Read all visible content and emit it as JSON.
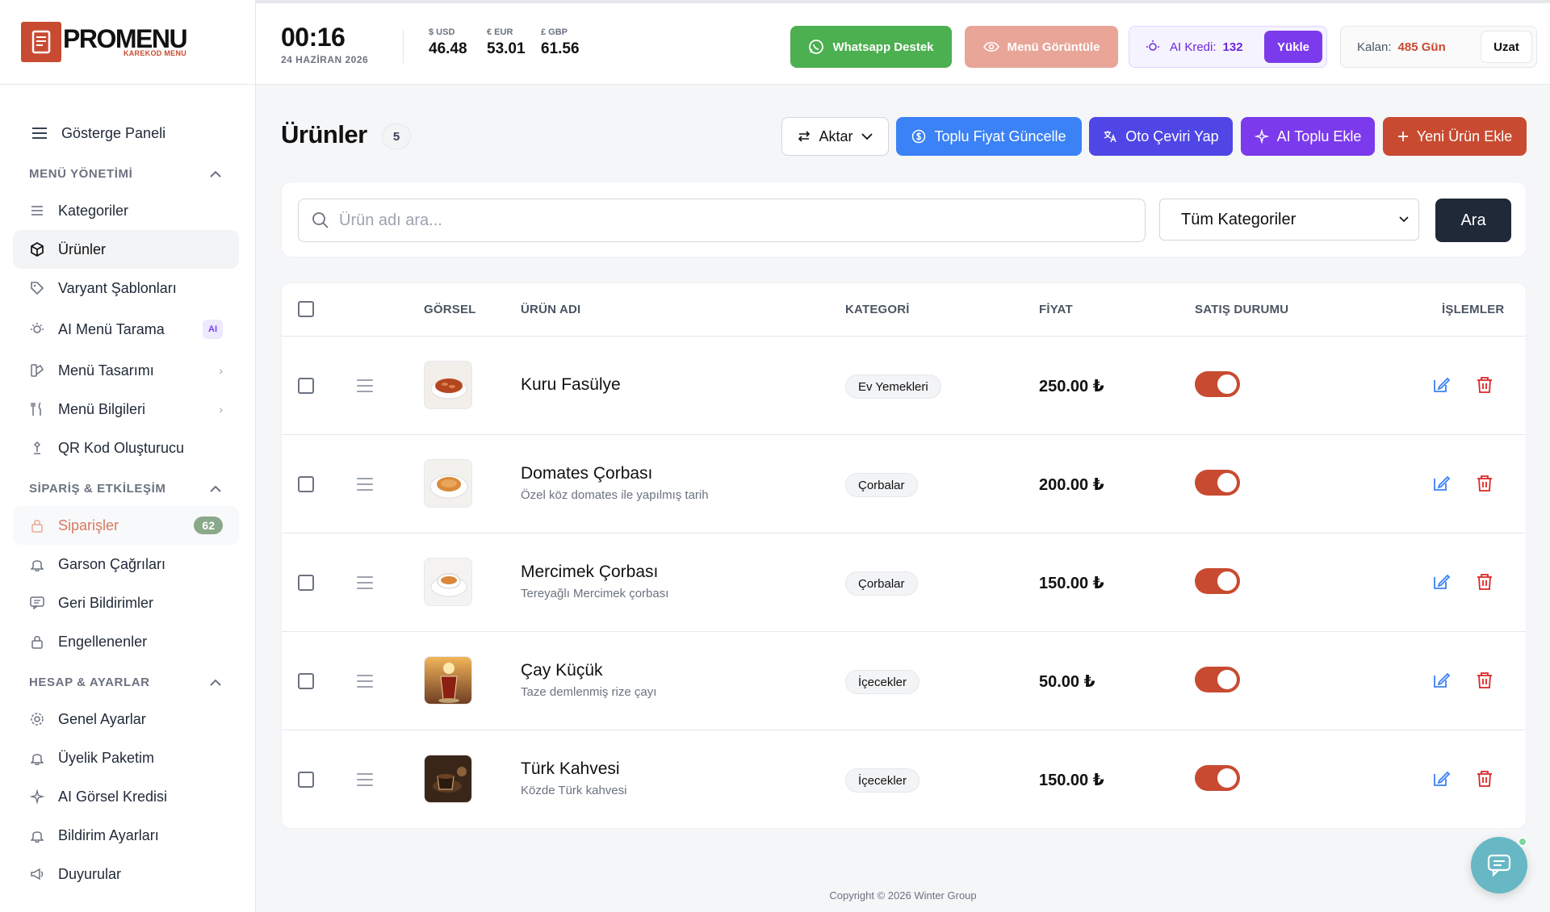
{
  "brand": {
    "name": "PROMENU",
    "sub": "KAREKOD MENU",
    "color": "#c84b31"
  },
  "header": {
    "time": "00:16",
    "date": "24 HAZİRAN 2026",
    "fx": [
      {
        "label": "$ USD",
        "value": "46.48"
      },
      {
        "label": "€ EUR",
        "value": "53.01"
      },
      {
        "label": "£ GBP",
        "value": "61.56"
      }
    ],
    "whatsapp_label": "Whatsapp Destek",
    "menu_view_label": "Menü Görüntüle",
    "ai_credit_label": "AI Kredi:",
    "ai_credit_value": "132",
    "load_label": "Yükle",
    "remaining_label": "Kalan:",
    "remaining_value": "485 Gün",
    "extend_label": "Uzat"
  },
  "sidebar": {
    "dashboard": "Gösterge Paneli",
    "sections": [
      {
        "title": "MENÜ YÖNETİMİ",
        "items": [
          "Kategoriler",
          "Ürünler",
          "Varyant Şablonları",
          "AI Menü Tarama",
          "Menü Tasarımı",
          "Menü Bilgileri",
          "QR Kod Oluşturucu"
        ]
      },
      {
        "title": "SİPARİŞ & ETKİLEŞİM",
        "items": [
          "Siparişler",
          "Garson Çağrıları",
          "Geri Bildirimler",
          "Engellenenler"
        ]
      },
      {
        "title": "HESAP & AYARLAR",
        "items": [
          "Genel Ayarlar",
          "Üyelik Paketim",
          "AI Görsel Kredisi",
          "Bildirim Ayarları",
          "Duyurular"
        ]
      }
    ],
    "ai_badge": "AI",
    "orders_count": "62"
  },
  "page": {
    "title": "Ürünler",
    "count": "5",
    "actions": {
      "aktar": "Aktar",
      "toplu": "Toplu Fiyat Güncelle",
      "ceviri": "Oto Çeviri Yap",
      "ai_toplu": "AI Toplu Ekle",
      "yeni": "Yeni Ürün Ekle"
    },
    "search_placeholder": "Ürün adı ara...",
    "category_select": "Tüm Kategoriler",
    "search_button": "Ara"
  },
  "table": {
    "headers": [
      "GÖRSEL",
      "ÜRÜN ADI",
      "KATEGORİ",
      "FİYAT",
      "SATIŞ DURUMU",
      "İŞLEMLER"
    ],
    "rows": [
      {
        "name": "Kuru Fasülye",
        "desc": "",
        "category": "Ev Yemekleri",
        "price": "250.00 ₺",
        "on_sale": true
      },
      {
        "name": "Domates Çorbası",
        "desc": "Özel köz domates ile yapılmış tarih",
        "category": "Çorbalar",
        "price": "200.00 ₺",
        "on_sale": true
      },
      {
        "name": "Mercimek Çorbası",
        "desc": "Tereyağlı Mercimek çorbası",
        "category": "Çorbalar",
        "price": "150.00 ₺",
        "on_sale": true
      },
      {
        "name": "Çay Küçük",
        "desc": "Taze demlenmiş rize çayı",
        "category": "İçecekler",
        "price": "50.00 ₺",
        "on_sale": true
      },
      {
        "name": "Türk Kahvesi",
        "desc": "Közde Türk kahvesi",
        "category": "İçecekler",
        "price": "150.00 ₺",
        "on_sale": true
      }
    ]
  },
  "footer": "Copyright © 2026 Winter Group"
}
